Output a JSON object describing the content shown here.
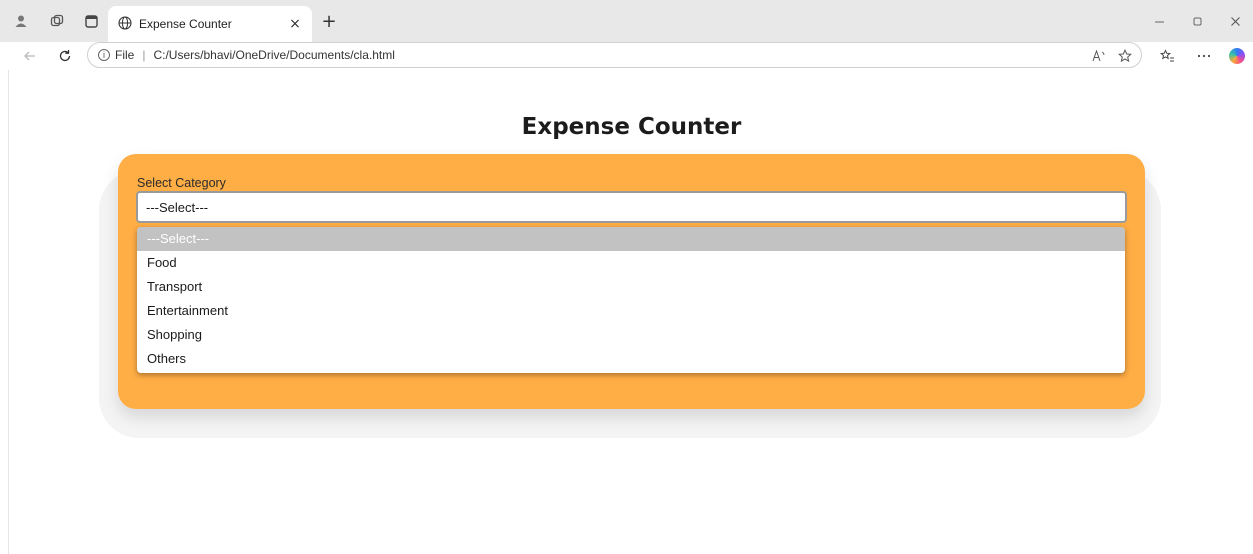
{
  "browser": {
    "tab_title": "Expense Counter",
    "tab_close": "×",
    "new_tab": "+",
    "url_scheme": "File",
    "url_path": "C:/Users/bhavi/OneDrive/Documents/cla.html",
    "info_glyph": "i"
  },
  "page": {
    "title": "Expense Counter",
    "category_label": "Select Category",
    "select_value": "---Select---",
    "dropdown_options": [
      "---Select---",
      "Food",
      "Transport",
      "Entertainment",
      "Shopping",
      "Others"
    ],
    "selected_index": 0
  },
  "colors": {
    "card": "#ffad45",
    "selected_option_bg": "#c2c2c2"
  }
}
